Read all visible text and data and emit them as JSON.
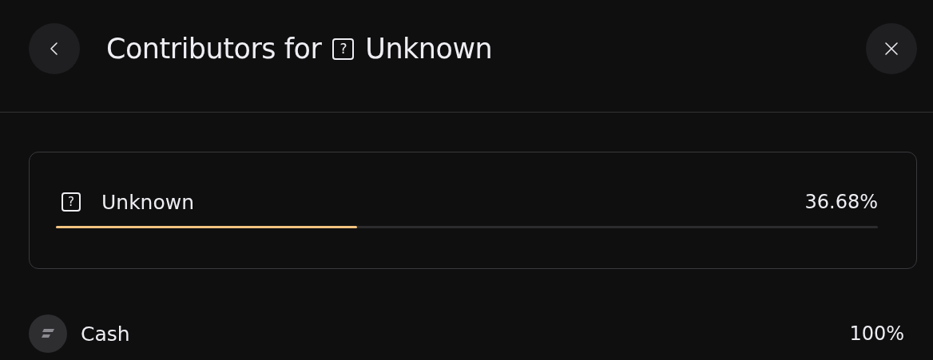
{
  "header": {
    "title_prefix": "Contributors for",
    "title_name": "Unknown",
    "icon": "?"
  },
  "summary": {
    "name": "Unknown",
    "icon": "?",
    "percent": "36.68%",
    "level": 0.3668
  },
  "contributors": [
    {
      "name": "Cash",
      "percent": "100%"
    }
  ]
}
